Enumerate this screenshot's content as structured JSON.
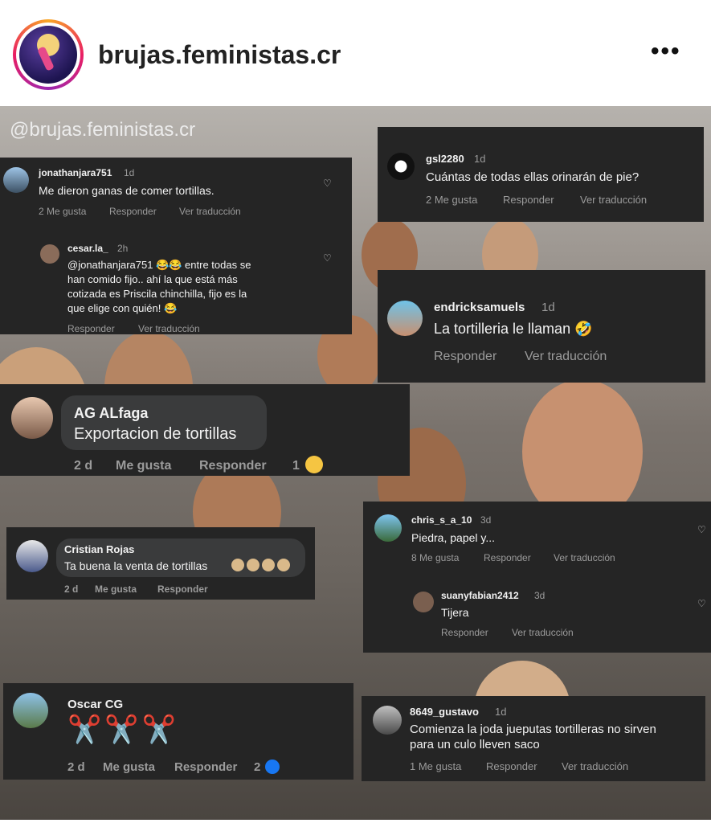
{
  "header": {
    "username": "brujas.feministas.cr",
    "more": "•••"
  },
  "watermark": "@brujas.feministas.cr",
  "c1": {
    "user": "jonathanjara751",
    "age": "1d",
    "text": "Me dieron ganas de comer tortillas.",
    "likes": "2 Me gusta",
    "reply": "Responder",
    "translate": "Ver traducción"
  },
  "c1r": {
    "user": "cesar.la_",
    "age": "2h",
    "line1": "@jonathanjara751 😂😂 entre todas se",
    "line2": "han comido fijo.. ahí la que está más",
    "line3": "cotizada es Priscila chinchilla, fijo es la",
    "line4": "que elige con quién! 😂",
    "reply": "Responder",
    "translate": "Ver traducción"
  },
  "c2": {
    "user": "gsl2280",
    "age": "1d",
    "text": "Cuántas de todas ellas orinarán de pie?",
    "likes": "2 Me gusta",
    "reply": "Responder",
    "translate": "Ver traducción"
  },
  "c3": {
    "user": "endricksamuels",
    "age": "1d",
    "text": "La tortilleria le llaman 🤣",
    "reply": "Responder",
    "translate": "Ver traducción"
  },
  "c4": {
    "user": "AG ALfaga",
    "text": "Exportacion de tortillas",
    "age": "2 d",
    "like": "Me gusta",
    "reply": "Responder",
    "count": "1"
  },
  "c5": {
    "user": "chris_s_a_10",
    "age": "3d",
    "text": "Piedra, papel y...",
    "likes": "8 Me gusta",
    "reply": "Responder",
    "translate": "Ver traducción"
  },
  "c5r": {
    "user": "suanyfabian2412",
    "age": "3d",
    "text": "Tijera",
    "reply": "Responder",
    "translate": "Ver traducción"
  },
  "c6": {
    "user": "Cristian Rojas",
    "text": "Ta buena la venta de tortillas",
    "age": "2 d",
    "like": "Me gusta",
    "reply": "Responder"
  },
  "c7": {
    "user": "Oscar CG",
    "scissors": "✂️✂️✂️",
    "age": "2 d",
    "like": "Me gusta",
    "reply": "Responder",
    "count": "2"
  },
  "c8": {
    "user": "8649_gustavo",
    "age": "1d",
    "line1": "Comienza la joda jueputas tortilleras no sirven",
    "line2": "para un culo lleven saco",
    "likes": "1 Me gusta",
    "reply": "Responder",
    "translate": "Ver traducción"
  }
}
